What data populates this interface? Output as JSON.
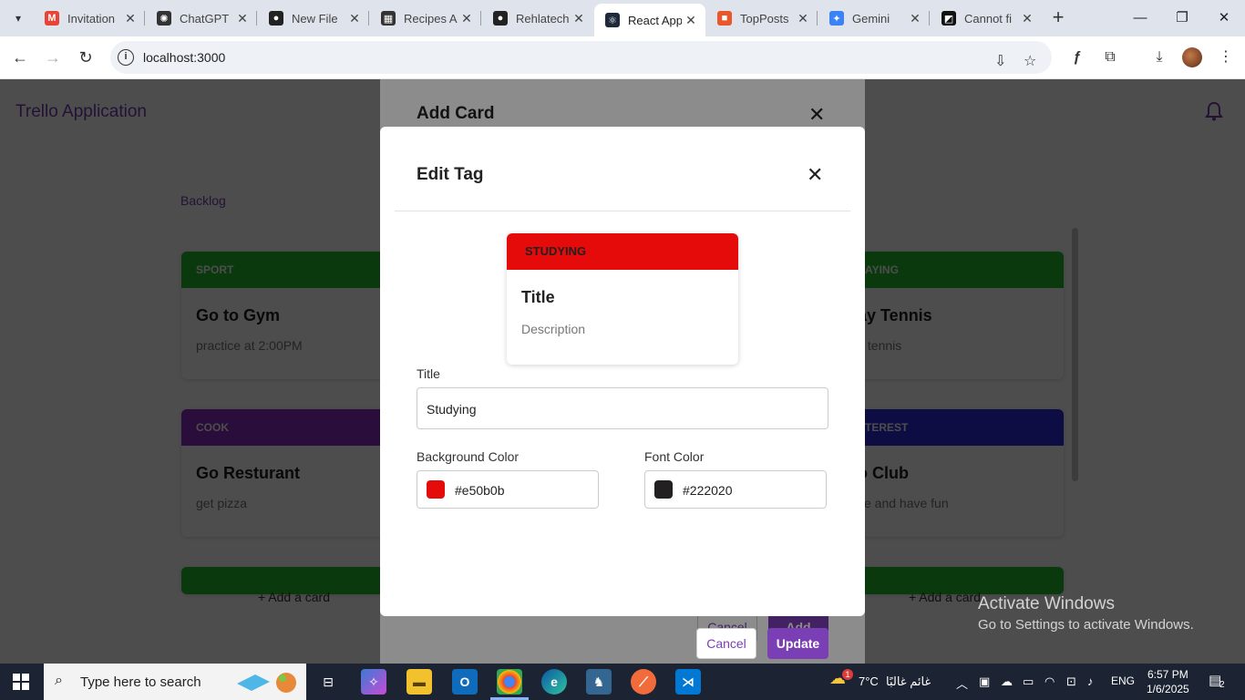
{
  "browser": {
    "tabs": [
      {
        "title": "Invitation",
        "icon": "gmail-icon",
        "color": "#ea4335",
        "glyph": "M"
      },
      {
        "title": "ChatGPT",
        "icon": "chatgpt-icon",
        "color": "#333333",
        "glyph": "✺"
      },
      {
        "title": "New File",
        "icon": "github-icon",
        "color": "#222222",
        "glyph": "●"
      },
      {
        "title": "Recipes A",
        "icon": "app-icon",
        "color": "#333333",
        "glyph": "▦"
      },
      {
        "title": "Rehlatech",
        "icon": "github-icon",
        "color": "#222222",
        "glyph": "●"
      },
      {
        "title": "React App",
        "icon": "react-icon",
        "color": "#1e2a3a",
        "glyph": "⚛"
      },
      {
        "title": "TopPosts",
        "icon": "topposts-icon",
        "color": "#e8582a",
        "glyph": "■"
      },
      {
        "title": "Gemini",
        "icon": "gemini-icon",
        "color": "#3b82f6",
        "glyph": "✦"
      },
      {
        "title": "Cannot fi",
        "icon": "notion-icon",
        "color": "#111111",
        "glyph": "◩"
      }
    ],
    "active_tab_index": 5,
    "url": "localhost:3000"
  },
  "app": {
    "title": "Trello Application",
    "column_title": "Backlog",
    "cards_left": [
      {
        "tag": "SPORT",
        "tag_bg": "#1fbf2a",
        "title": "Go to Gym",
        "desc": "practice at 2:00PM"
      },
      {
        "tag": "COOK",
        "tag_bg": "#8f2fc4",
        "title": "Go Resturant",
        "desc": "get pizza"
      }
    ],
    "cards_right": [
      {
        "tag": "AYING",
        "tag_bg": "#1fbf2a",
        "title": "ay Tennis",
        "desc": "y tennis"
      },
      {
        "tag": "TEREST",
        "tag_bg": "#2c2ce0",
        "title": "o Club",
        "desc": "ce and have fun"
      }
    ],
    "add_card_label": "+ Add a card",
    "add_card_label_right": "+ Add a card"
  },
  "add_card_modal": {
    "title": "Add Card",
    "cancel_label": "Cancel",
    "add_label": "Add"
  },
  "edit_tag_modal": {
    "title": "Edit Tag",
    "preview": {
      "tag": "STUDYING",
      "title": "Title",
      "description": "Description"
    },
    "title_label": "Title",
    "title_value": "Studying",
    "bg_color_label": "Background Color",
    "bg_color_value": "#e50b0b",
    "font_color_label": "Font Color",
    "font_color_value": "#222020",
    "cancel_label": "Cancel",
    "update_label": "Update"
  },
  "watermark": {
    "line1": "Activate Windows",
    "line2": "Go to Settings to activate Windows."
  },
  "taskbar": {
    "search_placeholder": "Type here to search",
    "weather_temp": "7°C",
    "weather_text": "غائم غالبًا",
    "weather_badge": "1",
    "language": "ENG",
    "time": "6:57 PM",
    "date": "1/6/2025",
    "notif_count": "2"
  }
}
